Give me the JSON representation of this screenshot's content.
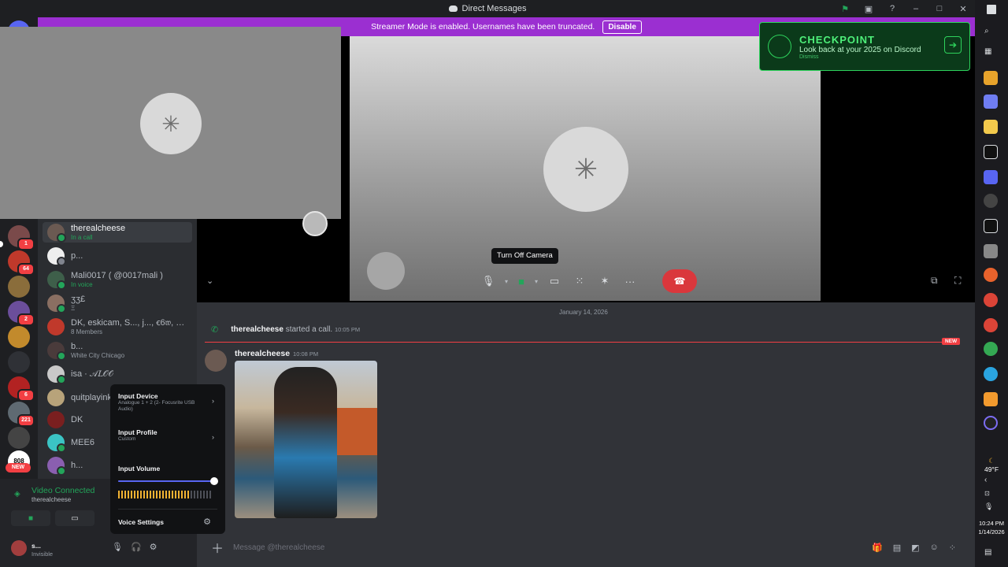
{
  "window": {
    "title": "Direct Messages"
  },
  "banner": {
    "text": "Streamer Mode is enabled. Usernames have been truncated.",
    "button": "Disable"
  },
  "checkpoint": {
    "title": "CHECKPOINT",
    "subtitle": "Look back at your 2025 on Discord",
    "small": "Dismiss"
  },
  "servers": {
    "badges": [
      "1",
      "64",
      "2",
      "6",
      "221"
    ],
    "new_label": "NEW",
    "mini_label": "808"
  },
  "dms": [
    {
      "name": "therealcheese",
      "sub": "In a call",
      "sub_green": true,
      "active": true
    },
    {
      "name": "p...",
      "sub": ""
    },
    {
      "name": "Mali0017 ( @0017mali )",
      "sub": "In voice",
      "sub_green": true
    },
    {
      "name": "ʒʒ£",
      "sub": "Ξ"
    },
    {
      "name": "DK, eskicam, S..., j..., ꞓ6𝔴, Chr...",
      "sub": "8 Members"
    },
    {
      "name": "b...",
      "sub": "White City Chicago",
      "sub_green": false
    },
    {
      "name": "isa · 𝒜𝐿𝒪𝒪",
      "sub": ""
    },
    {
      "name": "quitplayink",
      "sub": ""
    },
    {
      "name": "DK",
      "sub": ""
    },
    {
      "name": "MEE6",
      "sub": ""
    },
    {
      "name": "h...",
      "sub": ""
    }
  ],
  "call": {
    "tooltip": "Turn Off Camera"
  },
  "chat": {
    "date_divider": "January 14, 2026",
    "call_event": {
      "user": "therealcheese",
      "text": "started a call.",
      "time": "10:05 PM"
    },
    "new_label": "NEW",
    "message": {
      "author": "therealcheese",
      "time": "10:08 PM"
    },
    "composer_placeholder": "Message @therealcheese"
  },
  "voice": {
    "status": "Video Connected",
    "channel": "therealcheese"
  },
  "user": {
    "name": "s...",
    "status": "Invisible"
  },
  "audio_menu": {
    "input_device_label": "Input Device",
    "input_device_value": "Analogue 1 + 2 (2- Focusrite USB Audio)",
    "input_profile_label": "Input Profile",
    "input_profile_value": "Custom",
    "input_volume_label": "Input Volume",
    "input_volume": 1.0,
    "voice_settings_label": "Voice Settings"
  },
  "taskbar": {
    "temperature": "49°F",
    "time": "10:24 PM",
    "date": "1/14/2026"
  },
  "colors": {
    "accent": "#5865f2",
    "green": "#23a55a",
    "red": "#da373c",
    "banner": "#9b2fd1"
  }
}
